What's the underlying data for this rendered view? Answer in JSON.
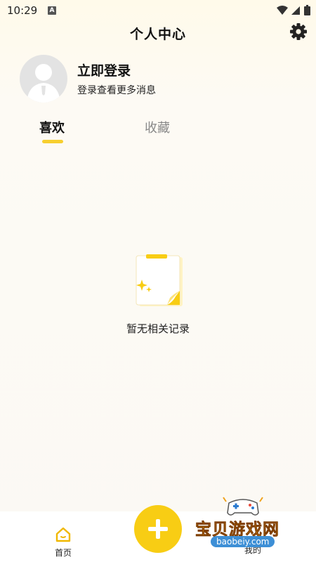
{
  "status_bar": {
    "time": "10:29",
    "notification_letter": "A"
  },
  "header": {
    "title": "个人中心"
  },
  "profile": {
    "login_title": "立即登录",
    "login_subtitle": "登录查看更多消息"
  },
  "tabs": [
    {
      "label": "喜欢",
      "active": true
    },
    {
      "label": "收藏",
      "active": false
    }
  ],
  "empty_state": {
    "text": "暂无相关记录"
  },
  "bottom_nav": {
    "home_label": "首页",
    "mine_label": "我的"
  },
  "watermark": {
    "text": "宝贝游戏网",
    "url": "baobeiy.com"
  },
  "colors": {
    "accent": "#f8cd14",
    "indicator": "#f7cf2f",
    "background": "#fbf9f4"
  }
}
